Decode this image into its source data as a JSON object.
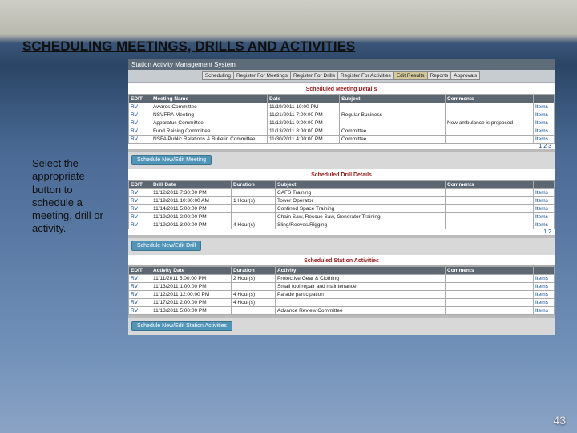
{
  "slide": {
    "title": "SCHEDULING MEETINGS, DRILLS AND ACTIVITIES",
    "hint": "Select the appropriate button to schedule a meeting, drill or activity.",
    "page": "43"
  },
  "app": {
    "title": "Station Activity Management System",
    "tabs": [
      "Scheduling",
      "Register For Meetings",
      "Register For Drills",
      "Register For Activities",
      "Edit Results",
      "Reports",
      "Approvals"
    ],
    "meetings": {
      "heading": "Scheduled Meeting Details",
      "cols": [
        "EDIT",
        "Meeting Name",
        "Date",
        "Subject",
        "Comments",
        ""
      ],
      "rows": [
        [
          "RV",
          "Awards Committee",
          "11/19/2011 10:00 PM",
          "",
          "",
          "Items"
        ],
        [
          "RV",
          "NSVFRA Meeting",
          "11/21/2011 7:00:00 PM",
          "Regular Business",
          "",
          "Items"
        ],
        [
          "RV",
          "Apparatus Committee",
          "11/12/2011 9:00:00 PM",
          "",
          "New ambulance is proposed",
          "Items"
        ],
        [
          "RV",
          "Fund Raising Committee",
          "11/13/2011 8:00:00 PM",
          "Committee",
          "",
          "Items"
        ],
        [
          "RV",
          "NSFA Public Relations & Bulletin Committee",
          "11/30/2011 4:00:00 PM",
          "Committee",
          "",
          "Items"
        ]
      ],
      "pager": "1 2 3",
      "button": "Schedule New/Edit Meeting"
    },
    "drills": {
      "heading": "Scheduled Drill Details",
      "cols": [
        "EDIT",
        "Drill Date",
        "Duration",
        "Subject",
        "Comments",
        ""
      ],
      "rows": [
        [
          "RV",
          "11/12/2011 7:30:00 PM",
          "",
          "CAFS Training",
          "",
          "Items"
        ],
        [
          "RV",
          "11/19/2011 10:30:00 AM",
          "1 Hour(s)",
          "Tower Operator",
          "",
          "Items"
        ],
        [
          "RV",
          "11/14/2011 5:00:00 PM",
          "",
          "Confined Space Training",
          "",
          "Items"
        ],
        [
          "RV",
          "11/19/2011 2:00:00 PM",
          "",
          "Chain Saw, Rescue Saw, Generator Training",
          "",
          "Items"
        ],
        [
          "RV",
          "11/19/2011 3:00:00 PM",
          "4 Hour(s)",
          "Sling/Reeves/Rigging",
          "",
          "Items"
        ]
      ],
      "pager": "1 2",
      "button": "Schedule New/Edit Drill"
    },
    "activities": {
      "heading": "Scheduled Station Activities",
      "cols": [
        "EDIT",
        "Activity Date",
        "Duration",
        "Activity",
        "Comments",
        ""
      ],
      "rows": [
        [
          "RV",
          "11/11/2011 5:00:00 PM",
          "2 Hour(s)",
          "Protective Gear & Clothing",
          "",
          "Items"
        ],
        [
          "RV",
          "11/13/2011 1:00:00 PM",
          "",
          "Small tool repair and maintenance",
          "",
          "Items"
        ],
        [
          "RV",
          "11/12/2011 12:00:00 PM",
          "4 Hour(s)",
          "Parade participation",
          "",
          "Items"
        ],
        [
          "RV",
          "11/17/2011 2:00:00 PM",
          "4 Hour(s)",
          "",
          "",
          "Items"
        ],
        [
          "RV",
          "11/13/2011 5:00:00 PM",
          "",
          "Advance Review Committee",
          "",
          "Items"
        ]
      ],
      "pager": "",
      "button": "Schedule New/Edit Station Activities"
    }
  }
}
